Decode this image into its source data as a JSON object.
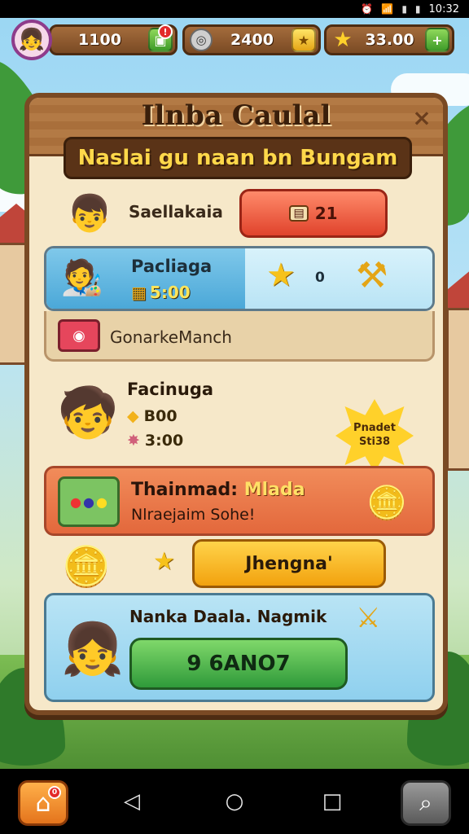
{
  "status_bar": {
    "time": "10:32"
  },
  "hud": {
    "resource1_value": "1100",
    "resource1_badge": "!",
    "resource2_value": "2400",
    "resource3_value": "33.00",
    "add_symbol": "+"
  },
  "panel": {
    "title": "Ilnba Caulal",
    "close_symbol": "×",
    "subtitle": "Naslai gu naan bn Bungam"
  },
  "row1": {
    "label": "Saellakaia",
    "button_value": "21"
  },
  "card2": {
    "title": "Pacliaga",
    "value": "5:00",
    "star_count": "0",
    "strip_text": "GonarkeManch"
  },
  "row3": {
    "title": "Facinuga",
    "value1": "B00",
    "value2": "3:00",
    "burst_line1": "Pnadet",
    "burst_line2": "Sti38"
  },
  "card4": {
    "title_part1": "Thainmad:",
    "title_part2": "Mlada",
    "subtitle": "Nlraejaim Sohe!"
  },
  "row5": {
    "button_label": "Jhengna'"
  },
  "card6": {
    "title": "Nanka Daala. Nagmik",
    "button_label": "9 6ANO7"
  },
  "nav": {
    "home_badge": "0"
  }
}
